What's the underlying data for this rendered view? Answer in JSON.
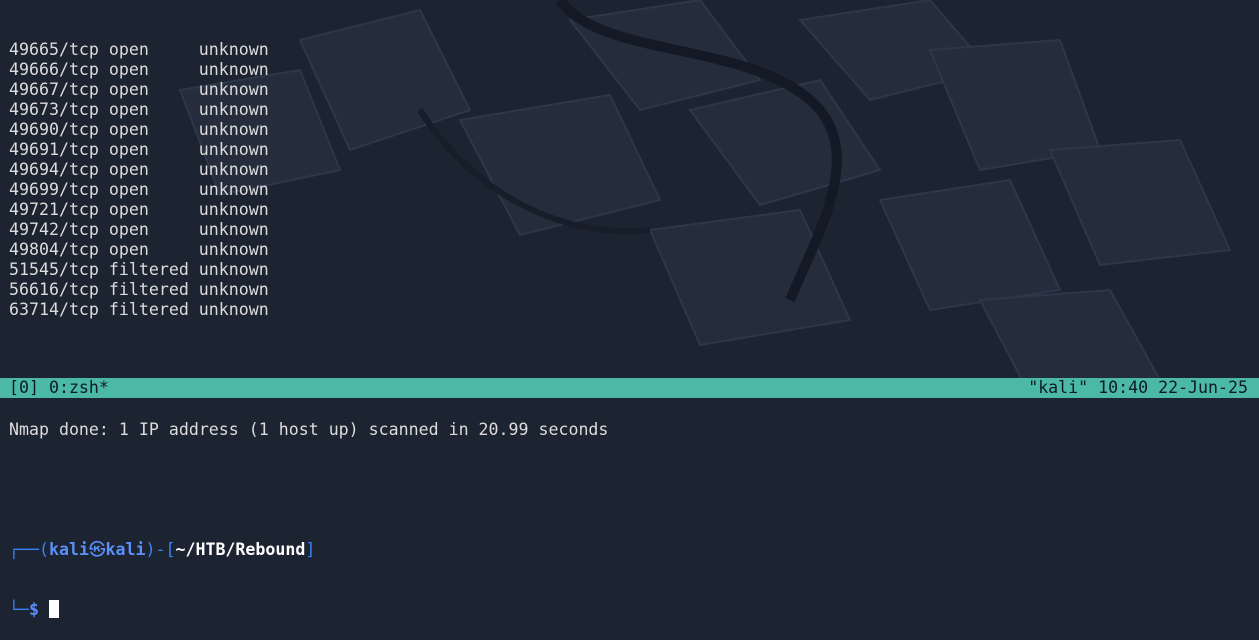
{
  "terminal": {
    "ports": [
      {
        "port": "49665/tcp",
        "state": "open",
        "service": "unknown"
      },
      {
        "port": "49666/tcp",
        "state": "open",
        "service": "unknown"
      },
      {
        "port": "49667/tcp",
        "state": "open",
        "service": "unknown"
      },
      {
        "port": "49673/tcp",
        "state": "open",
        "service": "unknown"
      },
      {
        "port": "49690/tcp",
        "state": "open",
        "service": "unknown"
      },
      {
        "port": "49691/tcp",
        "state": "open",
        "service": "unknown"
      },
      {
        "port": "49694/tcp",
        "state": "open",
        "service": "unknown"
      },
      {
        "port": "49699/tcp",
        "state": "open",
        "service": "unknown"
      },
      {
        "port": "49721/tcp",
        "state": "open",
        "service": "unknown"
      },
      {
        "port": "49742/tcp",
        "state": "open",
        "service": "unknown"
      },
      {
        "port": "49804/tcp",
        "state": "open",
        "service": "unknown"
      },
      {
        "port": "51545/tcp",
        "state": "filtered",
        "service": "unknown"
      },
      {
        "port": "56616/tcp",
        "state": "filtered",
        "service": "unknown"
      },
      {
        "port": "63714/tcp",
        "state": "filtered",
        "service": "unknown"
      }
    ],
    "summary": "Nmap done: 1 IP address (1 host up) scanned in 20.99 seconds",
    "prompt": {
      "frame_top": "┌──(",
      "user": "kali",
      "at_symbol": "㉿",
      "host": "kali",
      "mid": ")-[",
      "path": "~/HTB/Rebound",
      "close": "]",
      "frame_bottom": "└─",
      "dollar": "$"
    }
  },
  "status_bar": {
    "left": "[0] 0:zsh*",
    "right": "\"kali\" 10:40 22-Jun-25"
  },
  "colors": {
    "background": "#1c2331",
    "prompt_blue": "#5b8ff9",
    "status_bar_bg": "#4cb8a6"
  }
}
